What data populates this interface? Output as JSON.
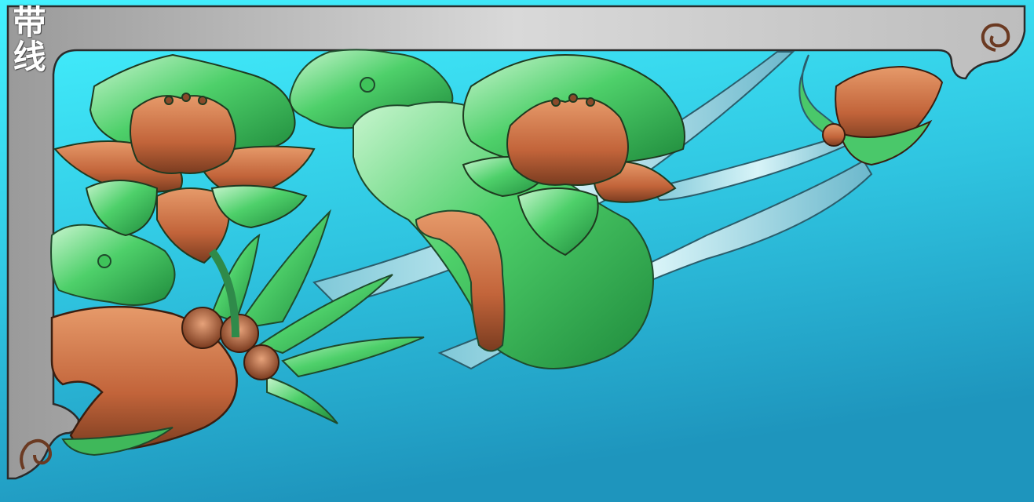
{
  "image": {
    "label": "带线",
    "colors": {
      "background_top": "#3ef0ff",
      "background_bottom": "#1f9cc4",
      "frame": "#c9c9c9",
      "frame_edge": "#2b2b2b",
      "leaf_green": "#3fc35a",
      "leaf_light": "#b9f0c8",
      "petal_copper": "#c96a3a",
      "petal_shadow": "#6b3a22",
      "stem_blue": "#9fd8e8"
    },
    "elements": [
      "corner-frame",
      "lotus-flower-left",
      "lotus-flower-center",
      "lotus-bud-right",
      "lotus-leaves",
      "ribbons",
      "lotus-seed-pods",
      "rock"
    ]
  }
}
